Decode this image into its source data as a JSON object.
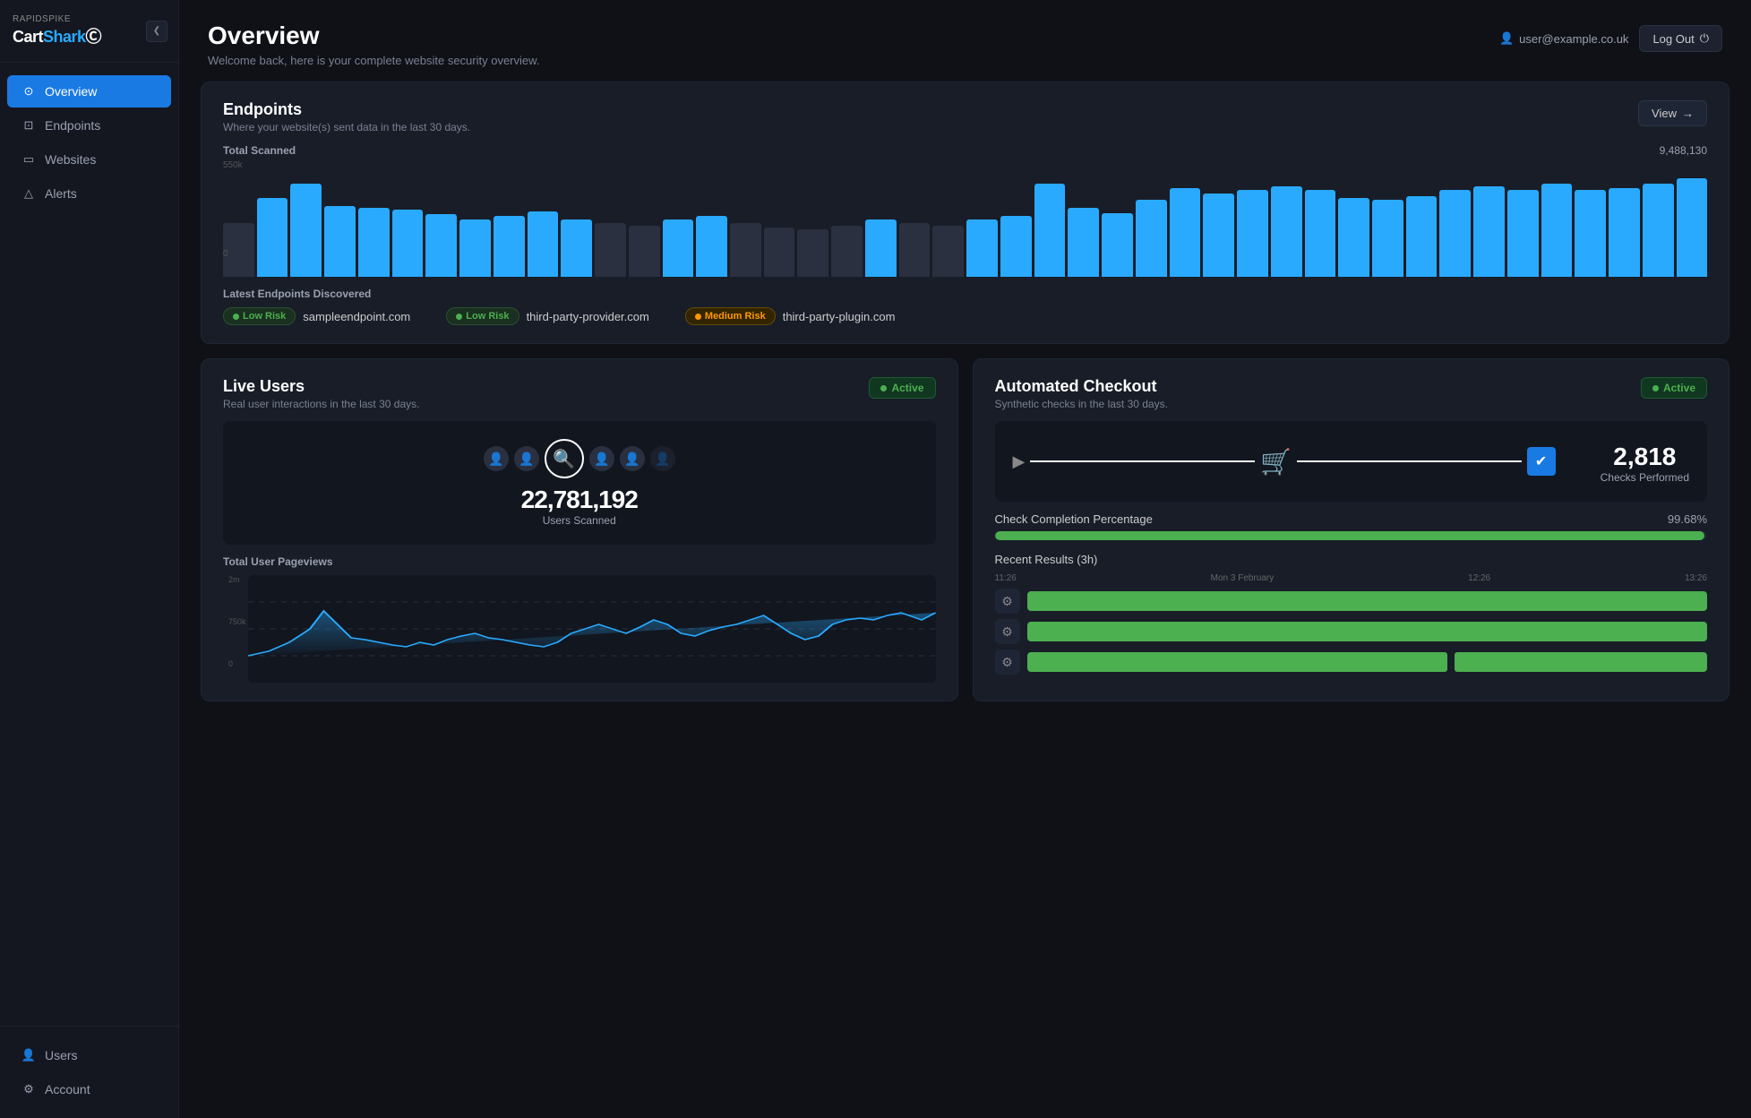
{
  "sidebar": {
    "logo_brand": "RAPIDSPIKE",
    "logo_name": "Cart",
    "logo_name2": "Shark",
    "collapse_btn": "❮",
    "nav_items": [
      {
        "id": "overview",
        "label": "Overview",
        "icon": "⊙",
        "active": true
      },
      {
        "id": "endpoints",
        "label": "Endpoints",
        "icon": "⊡",
        "active": false
      },
      {
        "id": "websites",
        "label": "Websites",
        "icon": "▭",
        "active": false
      },
      {
        "id": "alerts",
        "label": "Alerts",
        "icon": "△",
        "active": false
      }
    ],
    "bottom_items": [
      {
        "id": "users",
        "label": "Users",
        "icon": "👤"
      },
      {
        "id": "account",
        "label": "Account",
        "icon": "⚙"
      }
    ]
  },
  "header": {
    "title": "Overview",
    "subtitle": "Welcome back, here is your complete website security overview.",
    "user_email": "user@example.co.uk",
    "logout_label": "Log Out"
  },
  "endpoints_card": {
    "title": "Endpoints",
    "subtitle": "Where your website(s) sent data in the last 30 days.",
    "view_label": "View",
    "total_label": "Total Scanned",
    "total_value": "9,488,130",
    "y_max": "550k",
    "y_zero": "0",
    "bars": [
      55,
      80,
      95,
      72,
      70,
      68,
      64,
      58,
      62,
      66,
      58,
      55,
      52,
      58,
      62,
      55,
      50,
      48,
      52,
      58,
      55,
      52,
      58,
      62,
      95,
      70,
      65,
      78,
      90,
      85,
      88,
      92,
      88,
      80,
      78,
      82,
      88,
      92,
      88,
      95,
      88,
      90,
      95,
      100
    ],
    "latest_title": "Latest Endpoints Discovered",
    "endpoints": [
      {
        "risk": "low",
        "domain": "sampleendpoint.com"
      },
      {
        "risk": "low",
        "domain": "third-party-provider.com"
      },
      {
        "risk": "medium",
        "domain": "third-party-plugin.com"
      }
    ]
  },
  "live_users": {
    "title": "Live Users",
    "subtitle": "Real user interactions in the last 30 days.",
    "active_label": "Active",
    "scan_count": "22,781,192",
    "scan_label": "Users Scanned",
    "pageviews_title": "Total User Pageviews",
    "y_labels": [
      "2m",
      "750k",
      "0"
    ],
    "x_labels": []
  },
  "checkout": {
    "title": "Automated Checkout",
    "subtitle": "Synthetic checks in the last 30 days.",
    "active_label": "Active",
    "checks_count": "2,818",
    "checks_label": "Checks Performed",
    "completion_title": "Check Completion Percentage",
    "completion_value": "99.68%",
    "completion_pct": 99.68,
    "recent_title": "Recent Results (3h)",
    "timeline_left": "11:26",
    "timeline_mid": "Mon 3 February",
    "timeline_mid2": "12:26",
    "timeline_right": "13:26",
    "recent_rows": [
      {
        "full": true,
        "split": false
      },
      {
        "full": true,
        "split": false
      },
      {
        "full": false,
        "split": true
      }
    ]
  }
}
